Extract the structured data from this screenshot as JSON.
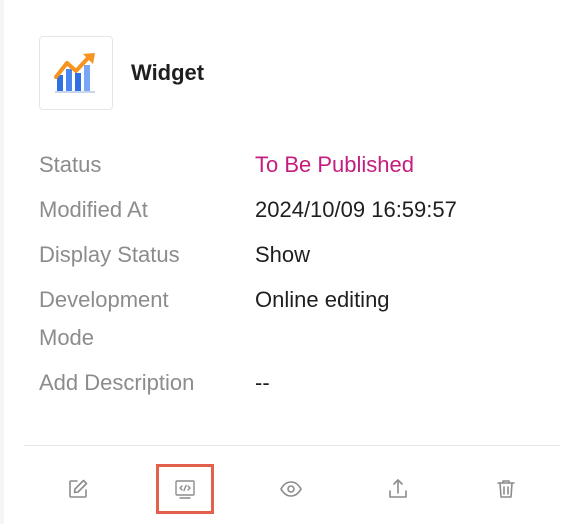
{
  "widget": {
    "title": "Widget",
    "icon": "chart-trend-icon"
  },
  "details": [
    {
      "label": "Status",
      "value": "To Be Published"
    },
    {
      "label": "Modified At",
      "value": "2024/10/09 16:59:57"
    },
    {
      "label": "Display Status",
      "value": "Show"
    },
    {
      "label": "Development Mode",
      "value": "Online editing"
    },
    {
      "label": "Add Description",
      "value": "--"
    }
  ],
  "toolbar": {
    "actions": [
      {
        "name": "edit",
        "icon": "edit-icon"
      },
      {
        "name": "code",
        "icon": "code-icon",
        "highlighted": true
      },
      {
        "name": "preview",
        "icon": "eye-icon"
      },
      {
        "name": "publish",
        "icon": "upload-icon"
      },
      {
        "name": "delete",
        "icon": "trash-icon"
      }
    ]
  },
  "colors": {
    "status_accent": "#c41d7f",
    "highlight_border": "#e2604c",
    "label_gray": "#8c8c8c"
  }
}
